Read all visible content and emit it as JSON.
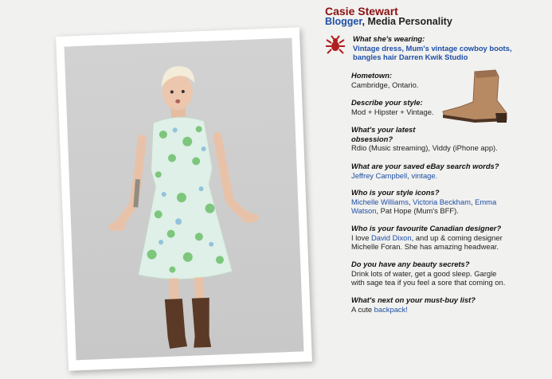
{
  "profile": {
    "name": "Casie Stewart",
    "role_link": "Blogger",
    "role_rest": ", Media Personality"
  },
  "wearing": {
    "q": "What she's wearing:",
    "a": "Vintage dress, Mum's vintage cowboy boots, bangles hair Darren Kwik Studio"
  },
  "hometown": {
    "q": "Hometown:",
    "a": "Cambridge, Ontario."
  },
  "style": {
    "q": "Describe your style:",
    "a": "Mod + Hipster + Vintage."
  },
  "obsession": {
    "q": "What's your latest obsession?",
    "a": "Rdio (Music streaming), Viddy (iPhone app)."
  },
  "ebay": {
    "q": "What are your saved eBay search words?",
    "link": "Jeffrey Campbell, vintage."
  },
  "icons": {
    "q": "Who is your style icons?",
    "link1": "Michelle Williams",
    "sep1": ", ",
    "link2": "Victoria Beckham",
    "sep2": ", ",
    "link3": "Emma Watson",
    "rest": ", Pat Hope (Mum's BFF)."
  },
  "designer": {
    "q": "Who is your favourite Canadian designer?",
    "pre": "I love ",
    "link": "David Dixon",
    "rest": ", and up & coming designer Michelle Foran. She has amazing headwear."
  },
  "beauty": {
    "q": "Do you have any beauty secrets?",
    "a": "Drink lots of water, get a good sleep. Gargle with sage tea if you feel a sore that coming on."
  },
  "mustbuy": {
    "q": "What's next on your must-buy list?",
    "pre": "A cute ",
    "link": "backpack!"
  },
  "colors": {
    "name": "#8a1010",
    "link": "#1f4fa6",
    "background": "#f1f1ef",
    "photo_bg": "#cccccc"
  },
  "icon_names": [
    "bug-icon",
    "cowboy-boot-image",
    "woman-portrait-photo"
  ]
}
